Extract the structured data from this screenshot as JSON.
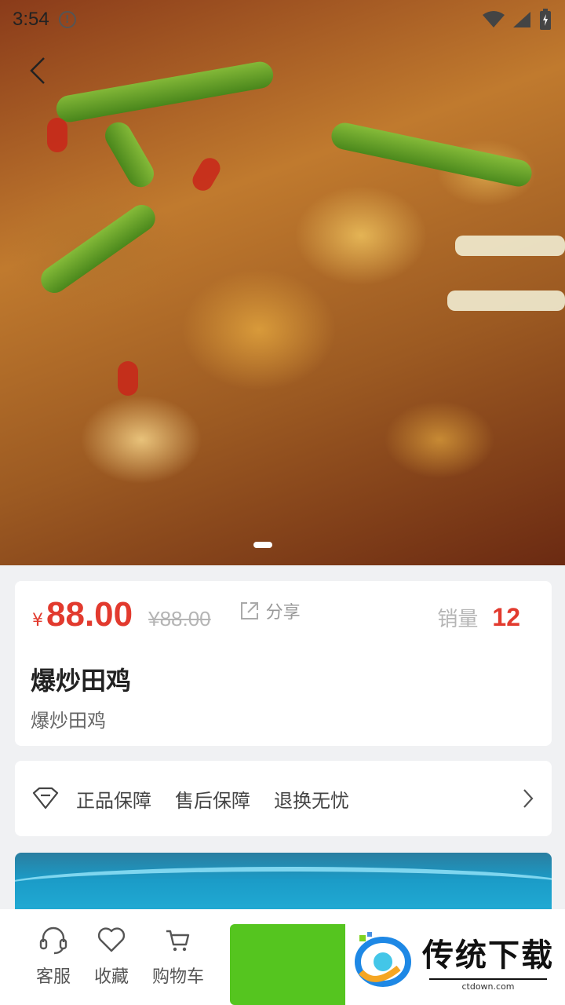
{
  "status_bar": {
    "time": "3:54"
  },
  "hero": {
    "page_indicator": {
      "current": 1,
      "total": 1
    }
  },
  "product": {
    "currency": "¥",
    "price": "88.00",
    "original_price": "¥88.00",
    "share_label": "分享",
    "sales_label": "销量",
    "sales_value": "12",
    "title": "爆炒田鸡",
    "subtitle": "爆炒田鸡"
  },
  "guarantees": [
    "正品保障",
    "售后保障",
    "退换无忧"
  ],
  "bottom_bar": {
    "service_label": "客服",
    "favorite_label": "收藏",
    "cart_label": "购物车"
  },
  "watermark": {
    "title": "传统下载",
    "url": "ctdown.com"
  },
  "colors": {
    "price_red": "#e23a2e",
    "buy_green": "#55c51f"
  }
}
